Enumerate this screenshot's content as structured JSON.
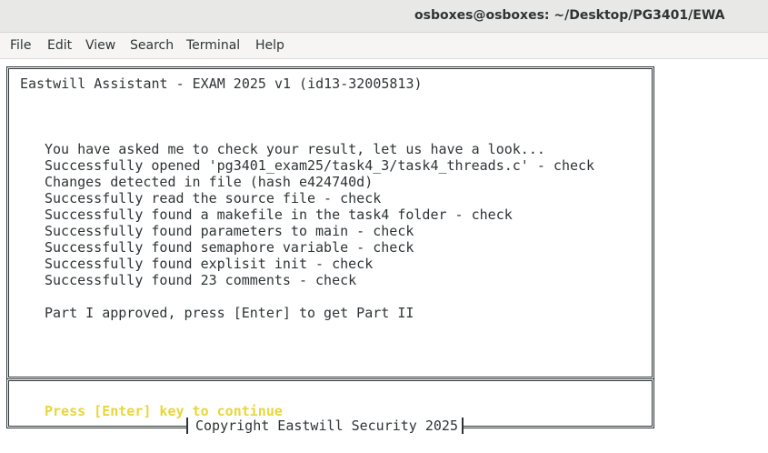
{
  "window": {
    "title": "osboxes@osboxes: ~/Desktop/PG3401/EWA"
  },
  "menubar": {
    "items": [
      "File",
      "Edit",
      "View",
      "Search",
      "Terminal",
      "Help"
    ]
  },
  "terminal": {
    "header": "Eastwill Assistant - EXAM 2025 v1 (id13-32005813)",
    "lines": [
      "You have asked me to check your result, let us have a look...",
      "Successfully opened 'pg3401_exam25/task4_3/task4_threads.c' - check",
      "Changes detected in file (hash e424740d)",
      "Successfully read the source file - check",
      "Successfully found a makefile in the task4 folder - check",
      "Successfully found parameters to main - check",
      "Successfully found semaphore variable - check",
      "Successfully found explisit init - check",
      "Successfully found 23 comments - check"
    ],
    "approval": "Part I approved, press [Enter] to get Part II",
    "prompt": "Press [Enter] key to continue",
    "copyright": "Copyright Eastwill Security 2025"
  },
  "colors": {
    "prompt": "#e8d63a",
    "text": "#2e3436",
    "background": "#ffffff"
  }
}
